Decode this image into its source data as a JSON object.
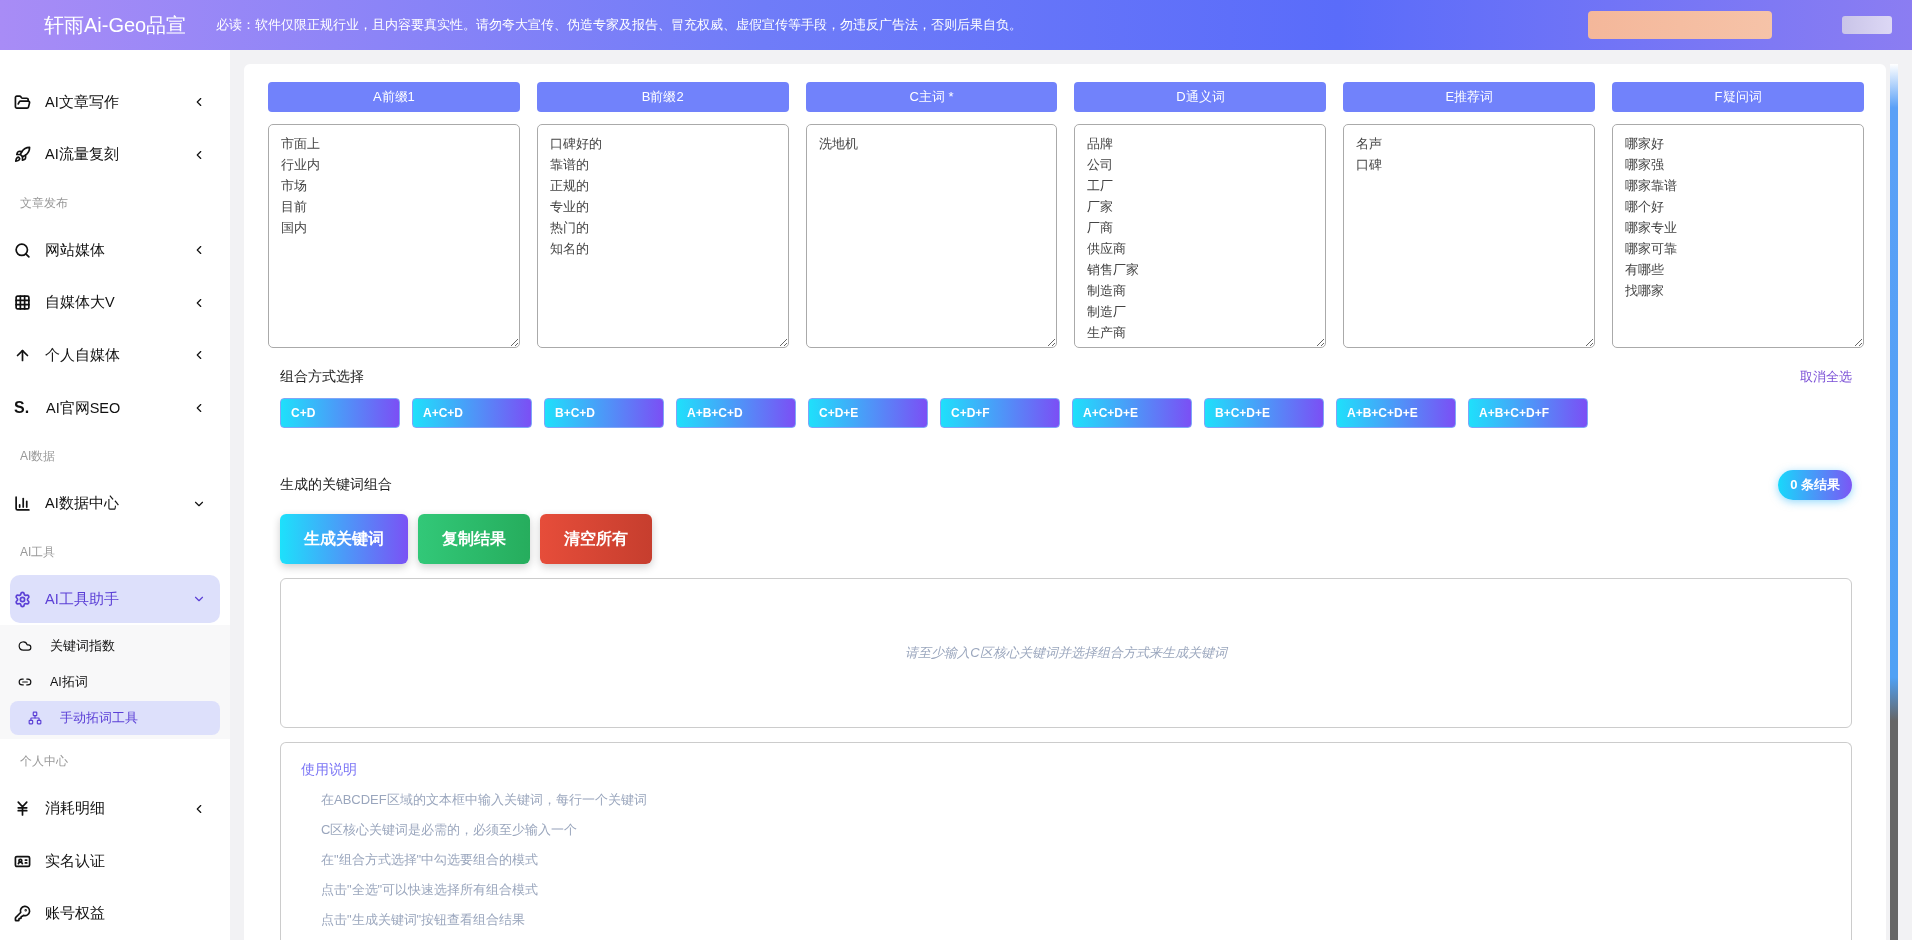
{
  "header": {
    "brand": "轩雨Ai-Geo品宣",
    "notice": "必读：软件仅限正规行业，且内容要真实性。请勿夸大宣传、伪造专家及报告、冒充权威、虚假宣传等手段，勿违反广告法，否则后果自负。"
  },
  "sidebar": [
    {
      "kind": "item",
      "label": "AI文章写作",
      "expanded": false,
      "selected": false
    },
    {
      "kind": "item",
      "label": "AI流量复刻",
      "expanded": false,
      "selected": false
    },
    {
      "kind": "section",
      "label": "文章发布"
    },
    {
      "kind": "item",
      "label": "网站媒体",
      "expanded": false,
      "selected": false
    },
    {
      "kind": "item",
      "label": "自媒体大V",
      "expanded": false,
      "selected": false
    },
    {
      "kind": "item",
      "label": "个人自媒体",
      "expanded": false,
      "selected": false
    },
    {
      "kind": "item",
      "label": "AI官网SEO",
      "icon_text": "S.",
      "expanded": false,
      "selected": false
    },
    {
      "kind": "section",
      "label": "AI数据"
    },
    {
      "kind": "item",
      "label": "AI数据中心",
      "expanded": true,
      "selected": false
    },
    {
      "kind": "section",
      "label": "AI工具"
    },
    {
      "kind": "item",
      "label": "AI工具助手",
      "expanded": true,
      "selected": true,
      "children": [
        {
          "label": "关键词指数",
          "selected": false
        },
        {
          "label": "AI拓词",
          "selected": false
        },
        {
          "label": "手动拓词工具",
          "selected": true
        }
      ]
    },
    {
      "kind": "section",
      "label": "个人中心"
    },
    {
      "kind": "item",
      "label": "消耗明细",
      "expanded": false,
      "selected": false
    },
    {
      "kind": "item",
      "label": "实名认证",
      "selected": false
    },
    {
      "kind": "item",
      "label": "账号权益",
      "selected": false
    }
  ],
  "columns": [
    {
      "title": "A前缀1",
      "lines": [
        "市面上",
        "行业内",
        "市场",
        "目前",
        "国内"
      ]
    },
    {
      "title": "B前缀2",
      "lines": [
        "口碑好的",
        "靠谱的",
        "正规的",
        "专业的",
        "热门的",
        "知名的"
      ]
    },
    {
      "title": "C主词 *",
      "lines": [
        "洗地机"
      ]
    },
    {
      "title": "D通义词",
      "lines": [
        "品牌",
        "公司",
        "工厂",
        "厂家",
        "厂商",
        "供应商",
        "销售厂家",
        "制造商",
        "制造厂",
        "生产商"
      ]
    },
    {
      "title": "E推荐词",
      "lines": [
        "名声",
        "口碑"
      ]
    },
    {
      "title": "F疑问词",
      "lines": [
        "哪家好",
        "哪家强",
        "哪家靠谱",
        "哪个好",
        "哪家专业",
        "哪家可靠",
        "有哪些",
        "找哪家"
      ]
    }
  ],
  "combination": {
    "title": "组合方式选择",
    "toggle_all": "取消全选",
    "modes": [
      {
        "label": "C+D",
        "selected": true
      },
      {
        "label": "A+C+D",
        "selected": true
      },
      {
        "label": "B+C+D",
        "selected": true
      },
      {
        "label": "A+B+C+D",
        "selected": true
      },
      {
        "label": "C+D+E",
        "selected": true
      },
      {
        "label": "C+D+F",
        "selected": true
      },
      {
        "label": "A+C+D+E",
        "selected": true
      },
      {
        "label": "B+C+D+E",
        "selected": true
      },
      {
        "label": "A+B+C+D+E",
        "selected": true
      },
      {
        "label": "A+B+C+D+F",
        "selected": true
      }
    ]
  },
  "results": {
    "title": "生成的关键词组合",
    "count": "0 条结果",
    "buttons": [
      {
        "kind": "generate",
        "label": "生成关键词"
      },
      {
        "kind": "copy",
        "label": "复制结果"
      },
      {
        "kind": "clear",
        "label": "清空所有"
      }
    ],
    "empty_text": "请至少输入C区核心关键词并选择组合方式来生成关键词"
  },
  "instructions": {
    "title": "使用说明",
    "items": [
      "在ABCDEF区域的文本框中输入关键词，每行一个关键词",
      "C区核心关键词是必需的，必须至少输入一个",
      "在\"组合方式选择\"中勾选要组合的模式",
      "点击\"全选\"可以快速选择所有组合模式",
      "点击\"生成关键词\"按钮查看组合结果"
    ]
  }
}
